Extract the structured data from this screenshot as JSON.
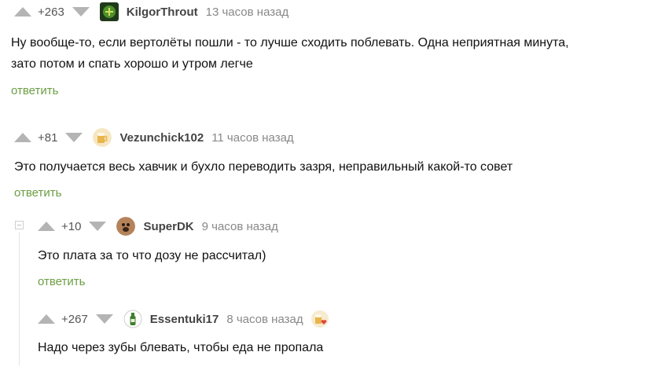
{
  "comments": [
    {
      "rating": "+263",
      "username": "KilgorThrout",
      "time": "13 часов назад",
      "text_lines": [
        "Ну вообще-то, если вертолёты пошли - то лучше сходить поблевать. Одна неприятная минута,",
        "зато потом и спать хорошо и утром легче"
      ],
      "reply": "ответить",
      "avatar_icon": "game-avatar-icon"
    },
    {
      "rating": "+81",
      "username": "Vezunchick102",
      "time": "11 часов назад",
      "text_lines": [
        "Это получается весь хавчик и бухло переводить зазря, неправильный какой-то совет"
      ],
      "reply": "ответить",
      "avatar_icon": "beer-avatar-icon"
    },
    {
      "rating": "+10",
      "username": "SuperDK",
      "time": "9 часов назад",
      "text_lines": [
        "Это плата за то что дозу не рассчитал)"
      ],
      "reply": "ответить",
      "avatar_icon": "dog-avatar-icon"
    },
    {
      "rating": "+267",
      "username": "Essentuki17",
      "time": "8 часов назад",
      "text_lines": [
        "Надо через зубы блевать, чтобы еда не пропала"
      ],
      "badge_icon": "beer-heart-badge-icon",
      "avatar_icon": "bottle-avatar-icon"
    }
  ],
  "colors": {
    "reply_link": "#6c9e43",
    "vote_arrow": "#b4b4b4",
    "thread_line": "#e3e3e3"
  }
}
